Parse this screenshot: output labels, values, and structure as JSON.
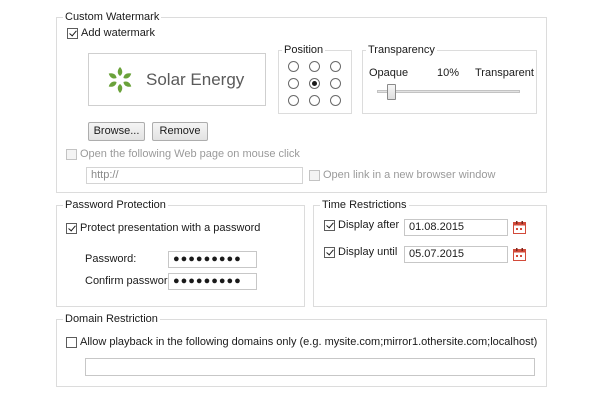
{
  "watermark": {
    "title": "Custom Watermark",
    "add_label": "Add watermark",
    "add_checked": true,
    "logo_text": "Solar Energy",
    "browse_label": "Browse...",
    "remove_label": "Remove",
    "position": {
      "title": "Position",
      "selected_index": 4
    },
    "transparency": {
      "title": "Transparency",
      "left_label": "Opaque",
      "value_text": "10%",
      "right_label": "Transparent",
      "value_percent": 10
    },
    "open_web_label": "Open the following Web page on mouse click",
    "open_web_checked": false,
    "url_value": "http://",
    "new_window_label": "Open link in a new browser window",
    "new_window_checked": false
  },
  "password": {
    "title": "Password Protection",
    "protect_label": "Protect presentation with a password",
    "protect_checked": true,
    "password_label": "Password:",
    "password_value": "●●●●●●●●●",
    "confirm_label": "Confirm password:",
    "confirm_value": "●●●●●●●●●"
  },
  "time": {
    "title": "Time Restrictions",
    "after_label": "Display after",
    "after_checked": true,
    "after_date": "01.08.2015",
    "until_label": "Display until",
    "until_checked": true,
    "until_date": "05.07.2015",
    "calendar_icon": "calendar-icon"
  },
  "domain": {
    "title": "Domain Restriction",
    "allow_label": "Allow playback in the following domains only (e.g. mysite.com;mirror1.othersite.com;localhost)",
    "allow_checked": false,
    "domains_value": ""
  },
  "colors": {
    "logo_green": "#6aa23a",
    "logo_text": "#5a5a5a",
    "calendar_red": "#d24a3a"
  }
}
